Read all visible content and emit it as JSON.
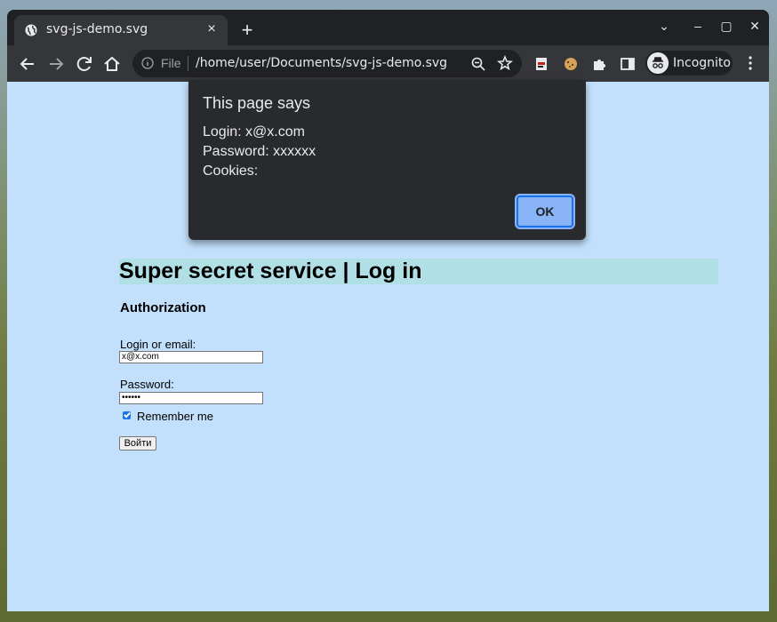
{
  "browser": {
    "tab_title": "svg-js-demo.svg",
    "tab_close": "×",
    "new_tab": "+",
    "window_controls": {
      "collapse": "⌄",
      "minimize": "–",
      "maximize": "▢",
      "close": "✕"
    },
    "omnibox": {
      "scheme": "File",
      "url": "/home/user/Documents/svg-js-demo.svg"
    },
    "profile_label": "Incognito"
  },
  "page": {
    "heading": "Super secret service | Log in",
    "subheading": "Authorization",
    "login_label": "Login or email:",
    "login_value": "x@x.com",
    "password_label": "Password:",
    "password_value": "••••••",
    "remember_label": "Remember me",
    "remember_checked": true,
    "submit_label": "Войти"
  },
  "dialog": {
    "title": "This page says",
    "lines": [
      "Login: x@x.com",
      "Password: xxxxxx",
      "Cookies:"
    ],
    "ok_label": "OK"
  },
  "colors": {
    "page_background": "#c2e0fb",
    "heading_background": "#b0e0e6",
    "dialog_background": "#292a2d",
    "ok_button": "#8ab4f8"
  }
}
